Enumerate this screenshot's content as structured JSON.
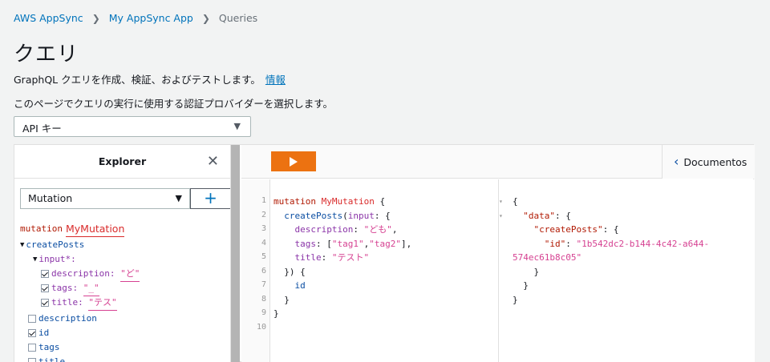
{
  "breadcrumb": {
    "items": [
      "AWS AppSync",
      "My AppSync App"
    ],
    "current": "Queries"
  },
  "page": {
    "title": "クエリ",
    "subtitle": "GraphQL クエリを作成、検証、およびテストします。",
    "info_link": "情報",
    "provider_label": "このページでクエリの実行に使用する認証プロバイダーを選択します。",
    "auth_provider_value": "API キー"
  },
  "explorer": {
    "title": "Explorer",
    "operation_type": "Mutation",
    "add_label": "+",
    "tree": {
      "keyword": "mutation",
      "op_name": "MyMutation",
      "field": "createPosts",
      "arg": "input*:",
      "description_label": "description:",
      "description_value": "\"ど\"",
      "tags_label": "tags:",
      "tags_value": "\"_\"",
      "title_label": "title:",
      "title_value": "\"テス\"",
      "sel_description": "description",
      "sel_id": "id",
      "sel_tags": "tags",
      "sel_title": "title"
    }
  },
  "toolbar": {
    "docs_label": "Documentos"
  },
  "editor": {
    "line_numbers": [
      "1",
      "2",
      "3",
      "4",
      "5",
      "6",
      "7",
      "8",
      "9",
      "10"
    ]
  },
  "colors": {
    "run_button": "#ec7211",
    "link": "#0073bb"
  }
}
